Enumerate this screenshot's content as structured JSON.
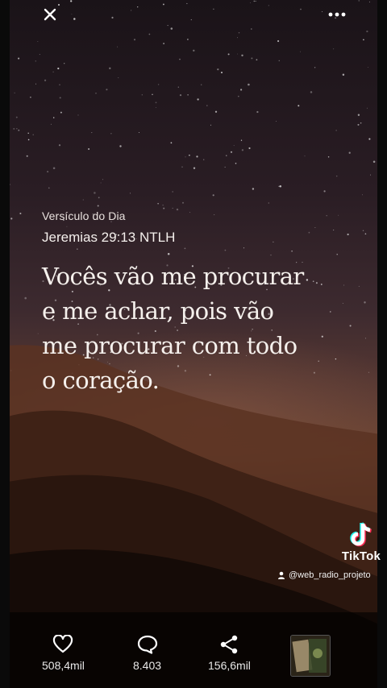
{
  "topbar": {
    "close_icon": "close-icon",
    "more_icon": "more-horizontal-icon"
  },
  "post": {
    "label": "Versículo do Dia",
    "reference": "Jeremias 29:13 NTLH",
    "text": "Vocês vão me procurar\ne me achar, pois vão\nme procurar com todo\no coração."
  },
  "watermark": {
    "brand": "TikTok",
    "username": "@web_radio_projeto"
  },
  "actions": {
    "likes": "508,4mil",
    "comments": "8.403",
    "shares": "156,6mil"
  },
  "colors": {
    "sky_top": "#1a1318",
    "sand": "#6f4632",
    "text": "#f5f0ec"
  }
}
